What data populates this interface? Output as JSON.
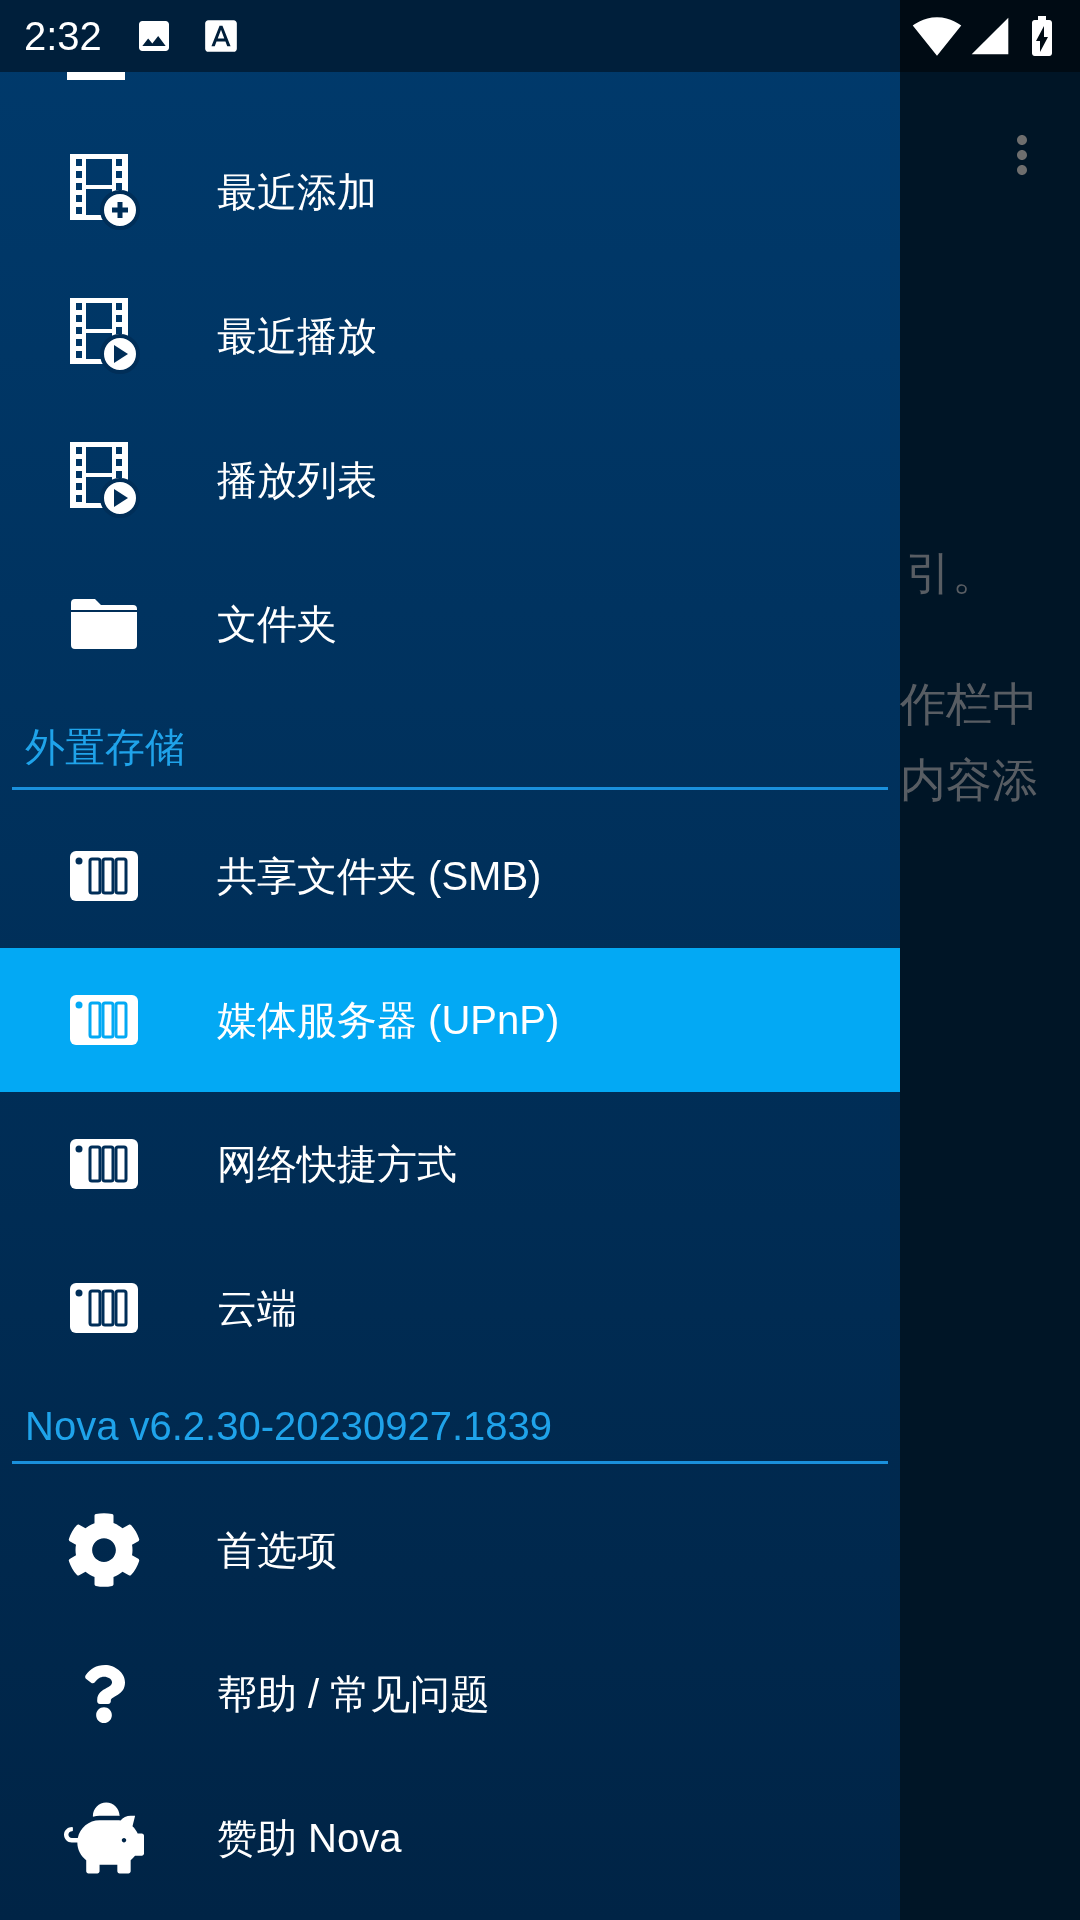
{
  "status_bar": {
    "time": "2:32"
  },
  "background": {
    "texts": [
      "引。",
      "作栏中",
      "内容添"
    ]
  },
  "drawer": {
    "sections": [
      {
        "items": [
          {
            "label": "最近添加",
            "kind": "film_add",
            "selected": false
          },
          {
            "label": "最近播放",
            "kind": "film_play",
            "selected": false
          },
          {
            "label": "播放列表",
            "kind": "film_play",
            "selected": false
          },
          {
            "label": "文件夹",
            "kind": "folder",
            "selected": false
          }
        ]
      },
      {
        "header": "外置存储",
        "items": [
          {
            "label": "共享文件夹 (SMB)",
            "kind": "nas",
            "selected": false
          },
          {
            "label": "媒体服务器 (UPnP)",
            "kind": "nas",
            "selected": true
          },
          {
            "label": "网络快捷方式",
            "kind": "nas",
            "selected": false
          },
          {
            "label": "云端",
            "kind": "nas",
            "selected": false
          }
        ]
      },
      {
        "header": "Nova v6.2.30-20230927.1839",
        "items": [
          {
            "label": "首选项",
            "kind": "gear",
            "selected": false
          },
          {
            "label": "帮助 / 常见问题",
            "kind": "help",
            "selected": false
          },
          {
            "label": "赞助 Nova",
            "kind": "piggy",
            "selected": false
          }
        ]
      }
    ]
  }
}
